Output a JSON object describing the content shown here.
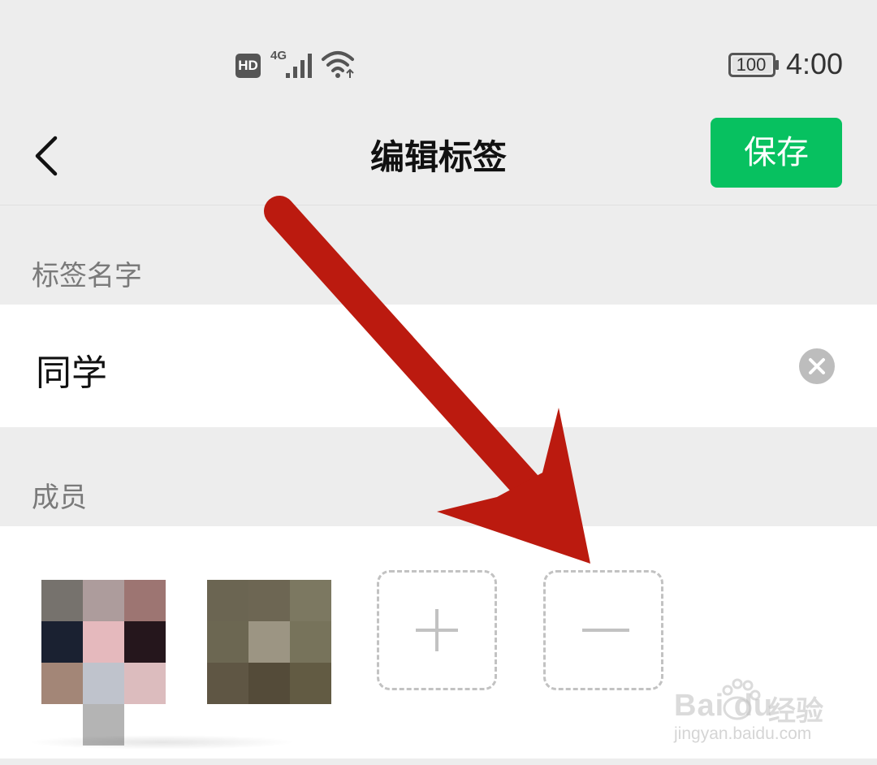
{
  "status_bar": {
    "hd_badge": "HD",
    "network_type": "4G",
    "battery_level": "100",
    "time": "4:00",
    "icons": [
      "signal-icon",
      "wifi-icon",
      "battery-icon"
    ]
  },
  "nav": {
    "back_icon": "chevron-left-icon",
    "title": "编辑标签",
    "save_label": "保存",
    "save_color": "#07c160"
  },
  "tag_name": {
    "section_label": "标签名字",
    "value": "同学",
    "clear_icon": "clear-circle-icon"
  },
  "members": {
    "section_label": "成员",
    "avatars": [
      {
        "name": "member-avatar-1",
        "pixelated": true
      },
      {
        "name": "member-avatar-2",
        "pixelated": true
      }
    ],
    "add_icon": "plus-icon",
    "remove_icon": "minus-icon"
  },
  "overlay": {
    "arrow_color": "#bb1a0f",
    "watermark_brand": "Bai  du",
    "watermark_text": "经验",
    "watermark_url": "jingyan.baidu.com"
  }
}
